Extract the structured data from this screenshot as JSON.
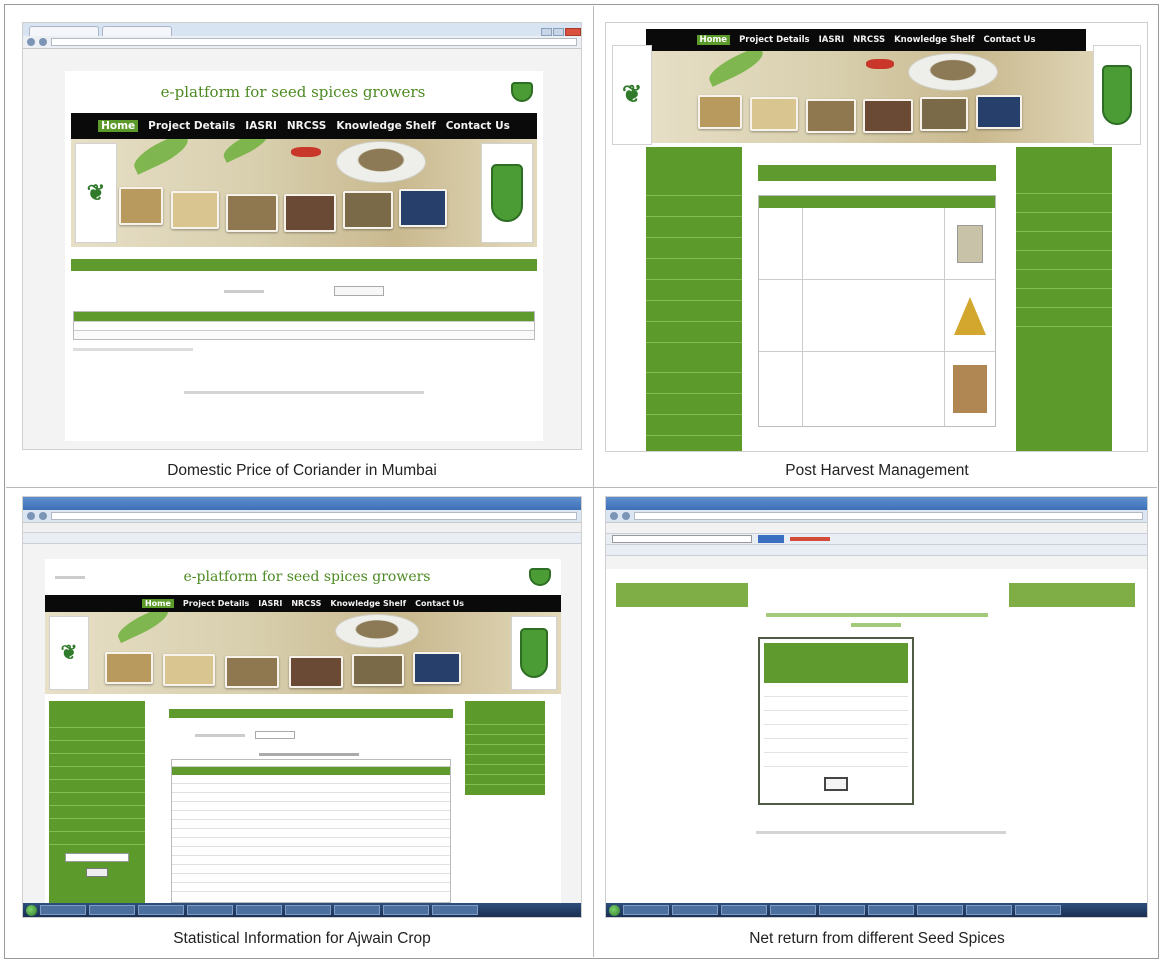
{
  "captions": {
    "tl": "Domestic Price of Coriander in Mumbai",
    "tr": "Post Harvest Management",
    "bl": "Statistical Information for Ajwain Crop",
    "br": "Net return from different Seed Spices"
  },
  "site": {
    "title": "e-platform for seed spices growers",
    "nav": [
      "Home",
      "Project Details",
      "IASRI",
      "NRCSS",
      "Knowledge Shelf",
      "Contact Us"
    ]
  },
  "colors": {
    "green": "#5e9a2d",
    "nav_black": "#0a0a0a",
    "title_green": "#4c8a22"
  },
  "icons": [
    "wheat-logo-icon",
    "nrcss-shield-logo-icon"
  ]
}
